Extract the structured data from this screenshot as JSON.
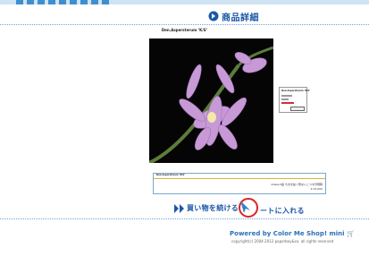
{
  "header": {
    "title": "商品詳細"
  },
  "product": {
    "name": "Den.Aspersterum ‘K/S’",
    "description": "※Select画 ちまを拡く際ないこつす月現時",
    "price": "¥ 23,000"
  },
  "actions": {
    "continue_label": "買い物を続ける",
    "cart_label": "ートに入れる"
  },
  "footer": {
    "powered": "Powered by Color Me Shop! mini",
    "copyright": "copyright(c) 2004-2012 paperboy&co. all rights reserved"
  },
  "colors": {
    "accent": "#1b57a8",
    "border": "#7da7cc"
  }
}
